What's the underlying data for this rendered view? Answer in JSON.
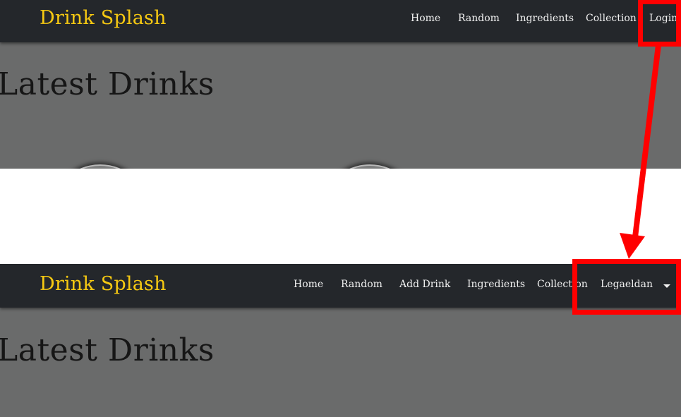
{
  "top": {
    "brand": "Drink Splash",
    "nav": {
      "home": "Home",
      "random": "Random",
      "ingredients": "Ingredients",
      "collection": "Collection",
      "login": "Login"
    },
    "heading": "Latest Drinks"
  },
  "bottom": {
    "brand": "Drink Splash",
    "nav": {
      "home": "Home",
      "random": "Random",
      "add_drink": "Add Drink",
      "ingredients": "Ingredients",
      "collection": "Collection",
      "user": "Legaeldan"
    },
    "heading": "Latest Drinks"
  },
  "colors": {
    "navbar": "#24272b",
    "brand": "#f6c912",
    "content_bg": "#6a6b6b",
    "annotation": "#ff0000"
  },
  "icons": {
    "user_menu": "caret-down-icon",
    "annotation_arrow": "arrow-icon"
  }
}
